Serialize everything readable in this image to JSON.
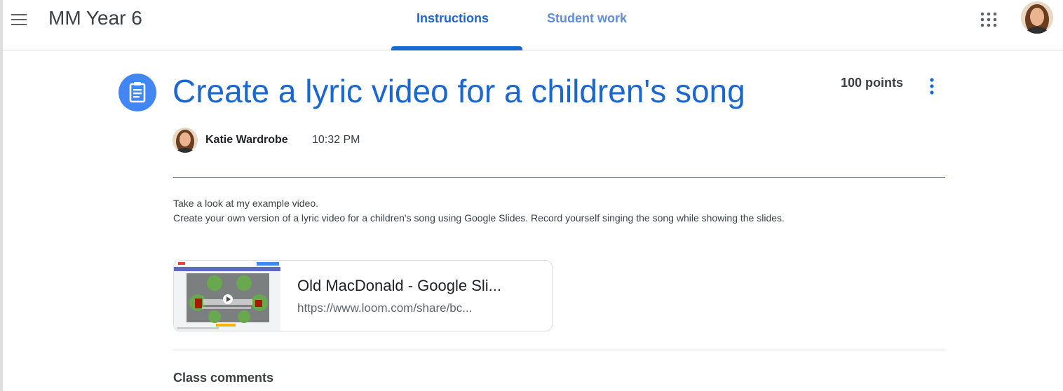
{
  "header": {
    "class_name": "MM Year 6",
    "tabs": [
      {
        "label": "Instructions",
        "active": true
      },
      {
        "label": "Student work",
        "active": false
      }
    ],
    "icons": {
      "menu": "menu-icon",
      "apps": "apps-grid-icon",
      "account": "user-avatar"
    }
  },
  "assignment": {
    "title": "Create a lyric video for a children's song",
    "points": "100 points",
    "author": "Katie Wardrobe",
    "time": "10:32 PM",
    "description": [
      "Take a look at my example video.",
      "Create your own version of a lyric video for a children's song using Google Slides. Record yourself singing the song while showing the slides."
    ],
    "attachment": {
      "title": "Old MacDonald - Google Sli...",
      "url": "https://www.loom.com/share/bc..."
    }
  },
  "comments": {
    "heading": "Class comments"
  },
  "colors": {
    "accent": "#1967d2",
    "assignment_icon_bg": "#4285f4",
    "divider": "#dadce0"
  }
}
